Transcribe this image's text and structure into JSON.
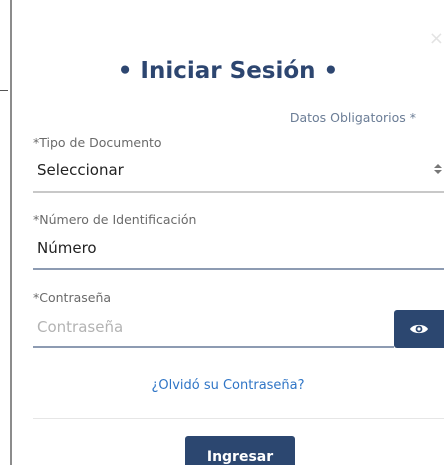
{
  "modal": {
    "close_glyph": "×",
    "title": "• Iniciar Sesión •",
    "required_note": "Datos Obligatorios *"
  },
  "document_type": {
    "label": "*Tipo de Documento",
    "selected_value": "Seleccionar"
  },
  "id_number": {
    "label": "*Número de Identificación",
    "value": "Número"
  },
  "password": {
    "label": "*Contraseña",
    "placeholder": "Contraseña",
    "toggle_icon": "eye-icon"
  },
  "forgot_password": {
    "label": "¿Olvidó su Contraseña?"
  },
  "submit": {
    "label": "Ingresar"
  },
  "colors": {
    "primary": "#2c4770",
    "link": "#2f75c6",
    "title": "#2d4670"
  }
}
